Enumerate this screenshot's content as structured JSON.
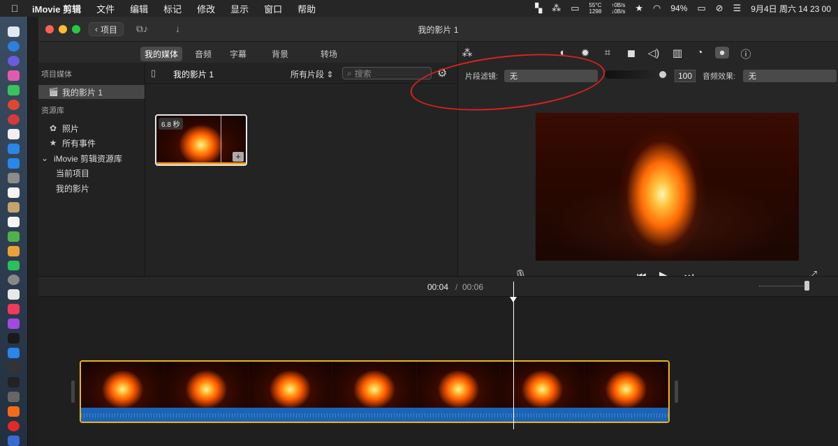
{
  "menubar": {
    "apple_icon": "apple-icon",
    "app_name": "iMovie 剪辑",
    "items": [
      "文件",
      "编辑",
      "标记",
      "修改",
      "显示",
      "窗口",
      "帮助"
    ],
    "temp": "55°C",
    "rpm": "1298",
    "net_up": "↑0B/s",
    "net_down": "↓0B/s",
    "battery": "94%",
    "datetime": "9月4日 周六  14 23 00"
  },
  "window": {
    "title": "我的影片 1",
    "back_button": "项目"
  },
  "media_tabs": [
    "我的媒体",
    "音频",
    "字幕",
    "背景",
    "转场"
  ],
  "sidebar": {
    "project_header": "项目媒体",
    "project_item": "我的影片 1",
    "library_header": "资源库",
    "photos": "照片",
    "all_events": "所有事件",
    "library_name": "iMovie 剪辑资源库",
    "current_project": "当前项目",
    "my_movie": "我的影片"
  },
  "browser": {
    "title": "我的影片 1",
    "filter": "所有片段",
    "search_placeholder": "搜索",
    "clip_duration": "6.8 秒"
  },
  "inspector": {
    "clip_filter_label": "片段滤镜:",
    "clip_filter_value": "无",
    "level": "100",
    "audio_effect_label": "音频效果:",
    "audio_effect_value": "无"
  },
  "timeline": {
    "current_time": "00:04",
    "separator": "/",
    "total_time": "00:06",
    "frame_count": 7
  },
  "colors": {
    "accent_yellow": "#f0b419",
    "annotation_red": "#d8231f",
    "audio_blue": "#1b63b5"
  }
}
